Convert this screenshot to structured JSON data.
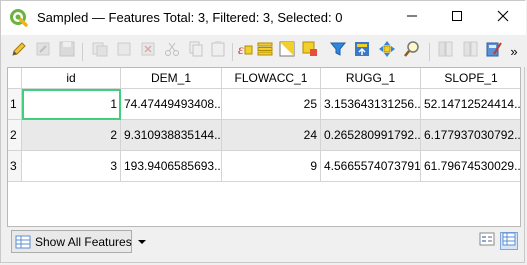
{
  "window": {
    "title": "Sampled — Features Total: 3, Filtered: 3, Selected: 0",
    "icon": "qgis-logo-icon",
    "controls": [
      "minimize-icon",
      "maximize-icon",
      "close-icon"
    ]
  },
  "toolbar": {
    "buttons": [
      {
        "icon": "edit-pencil-icon",
        "enabled": true
      },
      {
        "icon": "multi-edit-icon",
        "enabled": false
      },
      {
        "icon": "save-edits-icon",
        "enabled": false
      },
      {
        "icon": "reload-icon",
        "enabled": false
      },
      {
        "icon": "add-feature-icon",
        "enabled": false
      },
      {
        "icon": "delete-feature-icon",
        "enabled": false
      },
      {
        "icon": "cut-icon",
        "enabled": false
      },
      {
        "icon": "copy-icon",
        "enabled": false
      },
      {
        "icon": "paste-icon",
        "enabled": false
      },
      {
        "icon": "expression-select-icon",
        "enabled": true
      },
      {
        "icon": "select-all-icon",
        "enabled": true
      },
      {
        "icon": "invert-selection-icon",
        "enabled": true
      },
      {
        "icon": "deselect-all-icon",
        "enabled": true
      },
      {
        "icon": "filter-icon",
        "enabled": true
      },
      {
        "icon": "move-selection-top-icon",
        "enabled": true
      },
      {
        "icon": "pan-to-selected-icon",
        "enabled": true
      },
      {
        "icon": "zoom-to-selected-icon",
        "enabled": true
      },
      {
        "icon": "new-field-icon",
        "enabled": false
      },
      {
        "icon": "delete-field-icon",
        "enabled": false
      },
      {
        "icon": "field-calculator-icon",
        "enabled": true
      }
    ],
    "overflow_label": "»"
  },
  "table": {
    "columns": [
      "id",
      "DEM_1",
      "FLOWACC_1",
      "RUGG_1",
      "SLOPE_1"
    ],
    "rows": [
      {
        "n": "1",
        "cells": [
          "1",
          "74.47449493408...",
          "25",
          "3.153643131256...",
          "52.14712524414..."
        ]
      },
      {
        "n": "2",
        "cells": [
          "2",
          "9.310938835144...",
          "24",
          "0.265280991792...",
          "6.177937030792..."
        ]
      },
      {
        "n": "3",
        "cells": [
          "3",
          "193.9406585693...",
          "9",
          "4.56655740737915",
          "61.79674530029..."
        ]
      }
    ],
    "current_row": 0
  },
  "footer": {
    "filter_button_label": "Show All Features",
    "dropdown_icon": "chevron-down-icon",
    "view_buttons": [
      "form-view-icon",
      "table-view-icon"
    ]
  },
  "colors": {
    "selection_outline": "#3fcf7f",
    "alt_row": "#e9e9e9"
  }
}
